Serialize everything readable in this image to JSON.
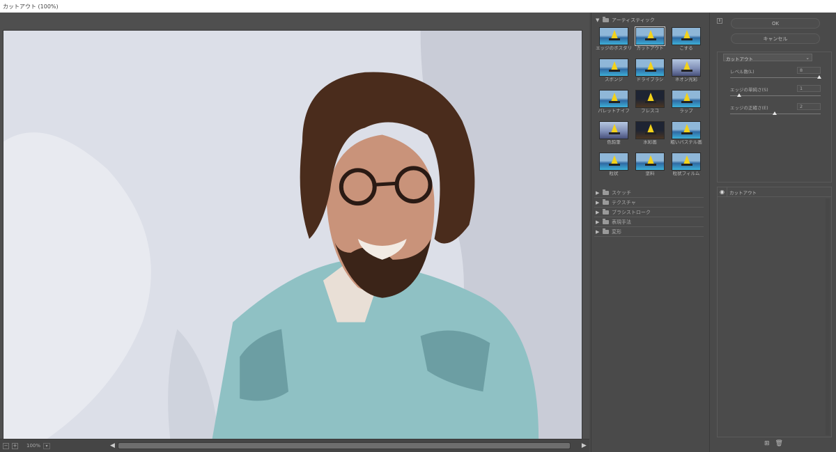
{
  "window": {
    "title": "カットアウト (100%)"
  },
  "preview": {
    "zoom": "100%"
  },
  "gallery": {
    "open_folder": "アーティスティック",
    "thumbnails": [
      {
        "label": "エッジのポスタリゼーション",
        "style": "normal"
      },
      {
        "label": "カットアウト",
        "style": "selected"
      },
      {
        "label": "こする",
        "style": "normal"
      },
      {
        "label": "スポンジ",
        "style": "normal"
      },
      {
        "label": "ドライブラシ",
        "style": "normal"
      },
      {
        "label": "ネオン光彩",
        "style": "neon"
      },
      {
        "label": "パレットナイフ",
        "style": "normal"
      },
      {
        "label": "フレスコ",
        "style": "dark"
      },
      {
        "label": "ラップ",
        "style": "normal"
      },
      {
        "label": "色鉛筆",
        "style": "neon"
      },
      {
        "label": "水彩画",
        "style": "dark"
      },
      {
        "label": "粗いパステル画",
        "style": "normal"
      },
      {
        "label": "粒状",
        "style": "normal"
      },
      {
        "label": "塗料",
        "style": "normal"
      },
      {
        "label": "粒状フィルム",
        "style": "normal"
      }
    ],
    "folders": [
      "スケッチ",
      "テクスチャ",
      "ブラシストローク",
      "表現手法",
      "変形"
    ]
  },
  "settings": {
    "ok_label": "OK",
    "cancel_label": "キャンセル",
    "collapse_icon": "⇕",
    "filter_selected": "カットアウト",
    "params": [
      {
        "label": "レベル数(L)",
        "value": "8",
        "level": 1.0
      },
      {
        "label": "エッジの単純さ(S)",
        "value": "1",
        "level": 0.1
      },
      {
        "label": "エッジの正確さ(E)",
        "value": "2",
        "level": 0.5
      }
    ],
    "layer_name": "カットアウト"
  },
  "colors": {
    "panel_bg": "#4a4a4a",
    "preview_bg": "#dde0e8",
    "shirt": "#8fc1c4",
    "hair": "#4a2c1c"
  },
  "icons": {
    "eye": "eye-icon",
    "new_layer": "new-layer-icon",
    "delete": "trash-icon"
  }
}
